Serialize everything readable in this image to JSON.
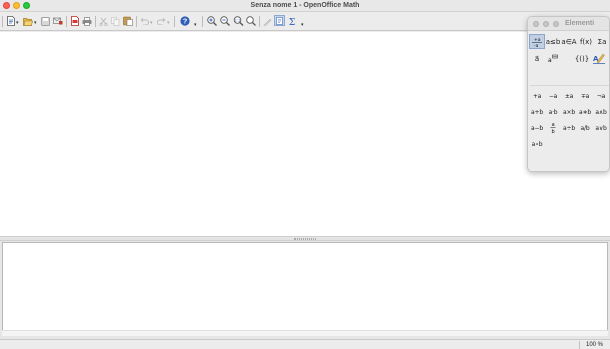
{
  "window": {
    "title": "Senza nome 1 - OpenOffice Math"
  },
  "toolbar": {
    "buttons": [
      {
        "name": "new-icon"
      },
      {
        "name": "open-icon"
      },
      {
        "name": "save-icon"
      },
      {
        "name": "mail-icon"
      },
      {
        "name": "export-pdf-icon"
      },
      {
        "name": "print-icon"
      },
      {
        "name": "cut-icon"
      },
      {
        "name": "copy-icon"
      },
      {
        "name": "paste-icon"
      },
      {
        "name": "undo-icon"
      },
      {
        "name": "redo-icon"
      },
      {
        "name": "help-icon"
      },
      {
        "name": "zoom-in-icon"
      },
      {
        "name": "zoom-out-icon"
      },
      {
        "name": "zoom-100-icon"
      },
      {
        "name": "show-all-icon"
      },
      {
        "name": "update-icon"
      },
      {
        "name": "formula-cursor-icon"
      },
      {
        "name": "symbols-icon"
      }
    ]
  },
  "elements_panel": {
    "title": "Elementi",
    "categories": [
      {
        "label": "+a/-a",
        "selected": true
      },
      {
        "label": "a≤b"
      },
      {
        "label": "a∈A"
      },
      {
        "label": "f(x)"
      },
      {
        "label": "Σa"
      },
      {
        "label": "a⃗"
      },
      {
        "label": "a▭"
      },
      {
        "label": "{()}"
      },
      {
        "label": "formatting"
      }
    ],
    "operators": [
      "+a",
      "−a",
      "±a",
      "∓a",
      "¬a",
      "a+b",
      "a·b",
      "a×b",
      "a∗b",
      "a∧b",
      "a−b",
      "a/b",
      "a÷b",
      "a/b",
      "a∨b",
      "a∘b"
    ]
  },
  "status": {
    "zoom": "100 %"
  },
  "colors": {
    "accent_selected": "#bfcfe6",
    "help_blue": "#2f5db8"
  }
}
